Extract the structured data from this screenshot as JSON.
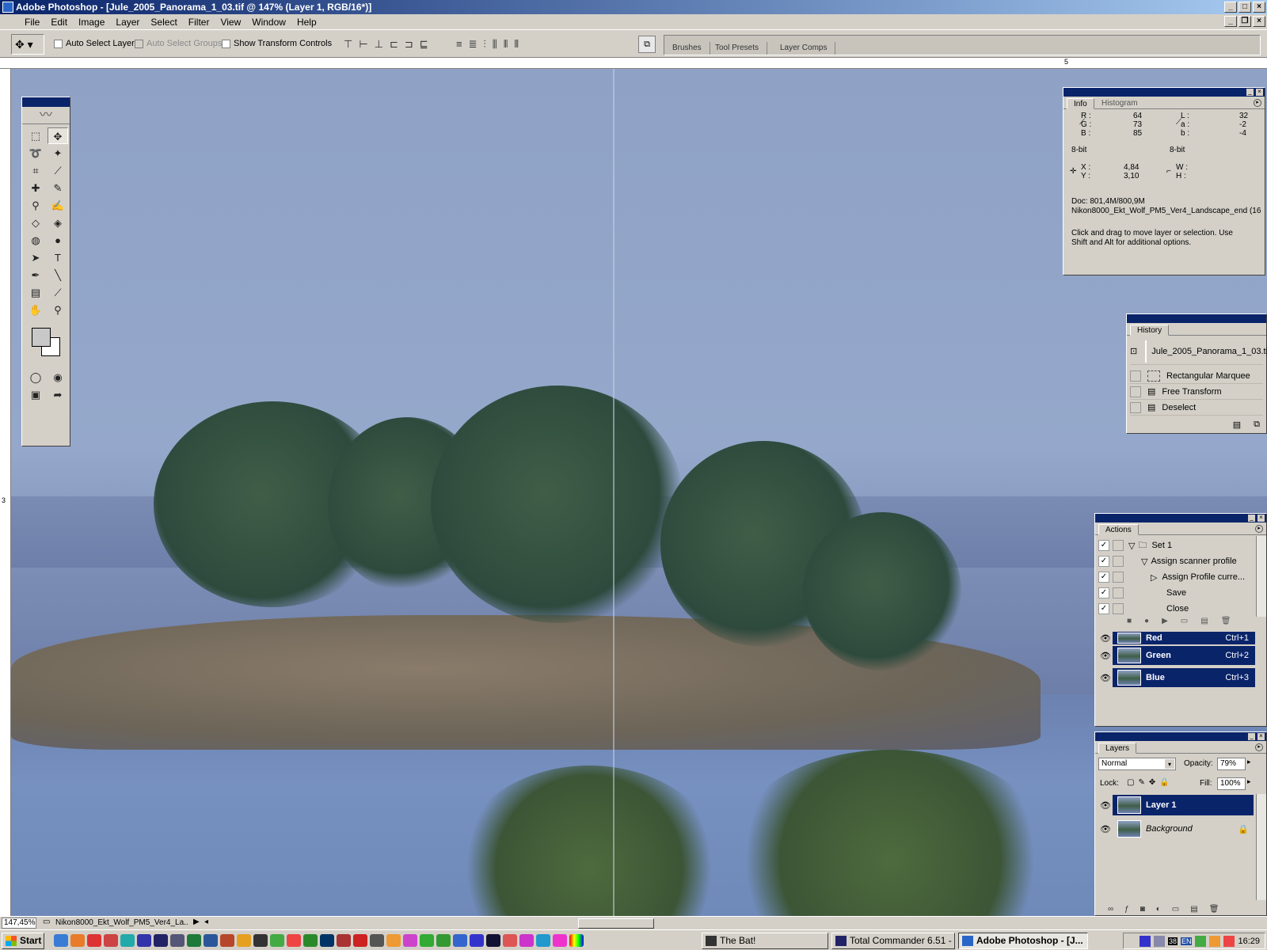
{
  "window": {
    "title": "Adobe Photoshop - [Jule_2005_Panorama_1_03.tif @ 147% (Layer 1, RGB/16*)]"
  },
  "menu": [
    "File",
    "Edit",
    "Image",
    "Layer",
    "Select",
    "Filter",
    "View",
    "Window",
    "Help"
  ],
  "options": {
    "auto_select_layer": "Auto Select Layer",
    "auto_select_groups": "Auto Select Groups",
    "show_transform": "Show Transform Controls",
    "align_icons": [
      "⊤",
      "⊢",
      "⊥",
      "⊏",
      "⊐",
      "⊑",
      "≡",
      "≣",
      "⫶",
      "⫼",
      "⦀",
      "⫴"
    ],
    "well_tabs": [
      "Brushes",
      "Tool Presets",
      "Layer Comps"
    ]
  },
  "rulers": {
    "top_label": "5",
    "left_label": "3"
  },
  "info_panel": {
    "tabs": [
      "Info",
      "Histogram"
    ],
    "r_label": "R :",
    "g_label": "G :",
    "b_label": "B :",
    "r": "64",
    "g": "73",
    "b": "85",
    "l_label": "L :",
    "a_label": "a :",
    "b2_label": "b :",
    "l": "32",
    "a": "-2",
    "b2": "-4",
    "bit_left": "8-bit",
    "bit_right": "8-bit",
    "x_label": "X :",
    "y_label": "Y :",
    "x": "4,84",
    "y": "3,10",
    "w_label": "W :",
    "h_label": "H :",
    "doc": "Doc: 801,4M/800,9M",
    "profile": "Nikon8000_Ekt_Wolf_PM5_Ver4_Landscape_end (16",
    "hint_line1": "Click and drag to move layer or selection.  Use",
    "hint_line2": "Shift and Alt for additional options."
  },
  "history_panel": {
    "tab": "History",
    "snapshot": "Jule_2005_Panorama_1_03.tif",
    "items": [
      "Rectangular Marquee",
      "Free Transform",
      "Deselect"
    ]
  },
  "actions_panel": {
    "tab": "Actions",
    "items": [
      {
        "label": "Set 1",
        "check": "✓"
      },
      {
        "label": "Assign scanner profile",
        "check": "✓"
      },
      {
        "label": "Assign Profile curre...",
        "check": "✓"
      },
      {
        "label": "Save",
        "check": "✓"
      },
      {
        "label": "Close",
        "check": "✓"
      }
    ]
  },
  "channels_panel": {
    "rows": [
      {
        "name": "Red",
        "shortcut": "Ctrl+1"
      },
      {
        "name": "Green",
        "shortcut": "Ctrl+2"
      },
      {
        "name": "Blue",
        "shortcut": "Ctrl+3"
      }
    ]
  },
  "layers_panel": {
    "tab": "Layers",
    "blend_mode": "Normal",
    "opacity_label": "Opacity:",
    "opacity": "79%",
    "lock_label": "Lock:",
    "fill_label": "Fill:",
    "fill": "100%",
    "layers": [
      {
        "name": "Layer 1",
        "selected": true
      },
      {
        "name": "Background",
        "selected": false
      }
    ]
  },
  "status": {
    "zoom": "147,45%",
    "profile": "Nikon8000_Ekt_Wolf_PM5_Ver4_La..."
  },
  "taskbar": {
    "start": "Start",
    "buttons": [
      {
        "label": "The Bat!"
      },
      {
        "label": "Total Commander 6.51 - ..."
      },
      {
        "label": "Adobe Photoshop - [J..."
      }
    ],
    "tray_text": "EN",
    "tray_num": "38",
    "clock": "16:29"
  },
  "colors": {
    "title_start": "#0a246a",
    "title_end": "#a6caf0",
    "selection": "#0a246a",
    "chrome": "#d4d0c8"
  }
}
